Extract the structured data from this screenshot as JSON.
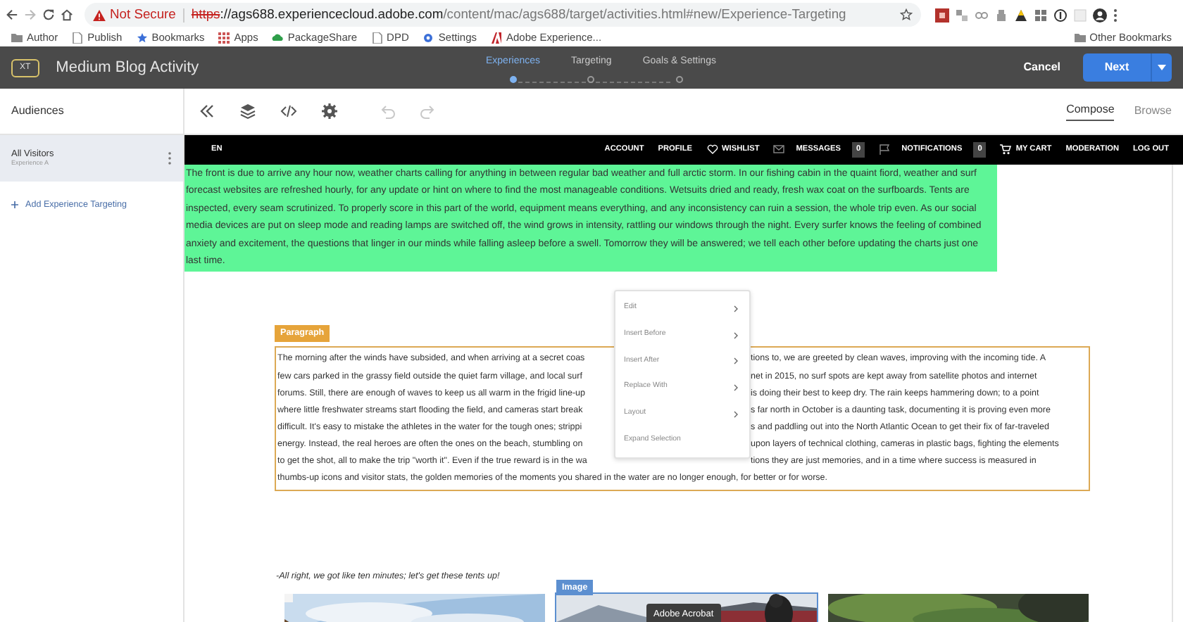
{
  "browser": {
    "security_label": "Not Secure",
    "url_scheme": "https",
    "url_host": "://ags688.experiencecloud.adobe.com",
    "url_path": "/content/mac/ags688/target/activities.html#new/Experience-Targeting",
    "bookmarks": [
      {
        "label": "Author",
        "kind": "folder"
      },
      {
        "label": "Publish",
        "kind": "page"
      },
      {
        "label": "Bookmarks",
        "kind": "star"
      },
      {
        "label": "Apps",
        "kind": "apps"
      },
      {
        "label": "PackageShare",
        "kind": "cloud"
      },
      {
        "label": "DPD",
        "kind": "page"
      },
      {
        "label": "Settings",
        "kind": "gear"
      },
      {
        "label": "Adobe Experience...",
        "kind": "adobe"
      }
    ],
    "other_bookmarks": "Other Bookmarks"
  },
  "app_header": {
    "badge": "XT",
    "title": "Medium Blog Activity",
    "steps": [
      {
        "label": "Experiences",
        "selected": true
      },
      {
        "label": "Targeting",
        "selected": false
      },
      {
        "label": "Goals & Settings",
        "selected": false
      }
    ],
    "cancel": "Cancel",
    "next": "Next"
  },
  "toolbar": {
    "panel_title": "Audiences",
    "tools": [
      {
        "kind": "collapse",
        "disabled": false
      },
      {
        "kind": "layers",
        "disabled": false
      },
      {
        "kind": "code",
        "disabled": false
      },
      {
        "kind": "settings",
        "disabled": false
      },
      {
        "kind": "undo",
        "disabled": true
      },
      {
        "kind": "redo",
        "disabled": true
      }
    ],
    "view_tabs": [
      {
        "label": "Compose",
        "selected": true
      },
      {
        "label": "Browse",
        "selected": false
      }
    ]
  },
  "sidebar": {
    "experiences": [
      {
        "name": "All Visitors",
        "subtitle": "Experience A",
        "selected": true
      }
    ],
    "add_link": "Add Experience Targeting"
  },
  "site_nav": {
    "language": "EN",
    "links": [
      {
        "label": "ACCOUNT",
        "kind": "text"
      },
      {
        "label": "PROFILE",
        "kind": "text"
      },
      {
        "label": "WISHLIST",
        "kind": "heart"
      },
      {
        "label": "MESSAGES",
        "kind": "mail",
        "count": "0"
      },
      {
        "label": "NOTIFICATIONS",
        "kind": "flag",
        "count": "0"
      },
      {
        "label": "MY CART",
        "kind": "cart"
      },
      {
        "label": "MODERATION",
        "kind": "text"
      },
      {
        "label": "LOG OUT",
        "kind": "text"
      }
    ]
  },
  "page": {
    "highlighted_paragraph": "The front is due to arrive any hour now, weather charts calling for anything in between regular bad weather and full arctic storm. In our fishing cabin in the quaint fiord, weather and surf forecast websites are refreshed hourly, for any update or hint on where to find the most manageable conditions. Wetsuits dried and ready, fresh wax coat on the surfboards. Tents are inspected, every seam scrutinized. To properly score in this part of the world, equipment means everything, and any inconsistency can ruin a session, the whole trip even. As our social media devices are put on sleep mode and reading lamps are switched off, the wind grows in intensity, rattling our windows through the night. Every surfer knows the feeling of combined anxiety and excitement, the questions that linger in our minds while falling asleep before a swell. Tomorrow they will be answered; we tell each other before updating the charts just one last time.",
    "paragraph_label": "Paragraph",
    "paragraph_lines": [
      {
        "left": "The morning after the winds have subsided, and when arriving at a secret coas",
        "right": "tions to, we are greeted by clean waves, improving with the incoming tide. A"
      },
      {
        "left": "few cars parked in the grassy field outside the quiet farm village, and local surf",
        "right": "net in 2015, no surf spots are kept away from satellite photos and internet"
      },
      {
        "left": "forums. Still, there are enough of waves to keep us all warm in the frigid line-up",
        "right": "is doing their best to keep dry. The rain keeps hammering down; to a point"
      },
      {
        "left": "where little freshwater streams start flooding the field, and cameras start break",
        "right": "s far north in October is a daunting task, documenting it is proving even more"
      },
      {
        "left": "difficult. It's easy to mistake the athletes in the water for the tough ones; strippi",
        "right": "s and paddling out into the North Atlantic Ocean to get their fix of far-traveled"
      },
      {
        "left": "energy. Instead, the real heroes are often the ones on the beach, stumbling on",
        "right": "upon layers of technical clothing, cameras in plastic bags, fighting the elements"
      },
      {
        "left": "to get the shot, all to make the trip \"worth it\". Even if the true reward is in the wa",
        "right": "tions they are just memories, and in a time where success is measured in"
      },
      {
        "left": "thumbs-up icons and visitor stats, the golden memories of the moments you shared in the water are no longer enough, for better or for worse."
      }
    ],
    "quote": "-All right, we got like ten minutes; let's get these tents up!",
    "image_label": "Image"
  },
  "context_menu": {
    "items": [
      {
        "label": "Edit",
        "submenu": true
      },
      {
        "label": "Insert Before",
        "submenu": true
      },
      {
        "label": "Insert After",
        "submenu": true
      },
      {
        "label": "Replace With",
        "submenu": true
      },
      {
        "label": "Layout",
        "submenu": true
      },
      {
        "label": "Expand Selection",
        "submenu": false
      }
    ]
  },
  "tooltip": "Adobe Acrobat"
}
